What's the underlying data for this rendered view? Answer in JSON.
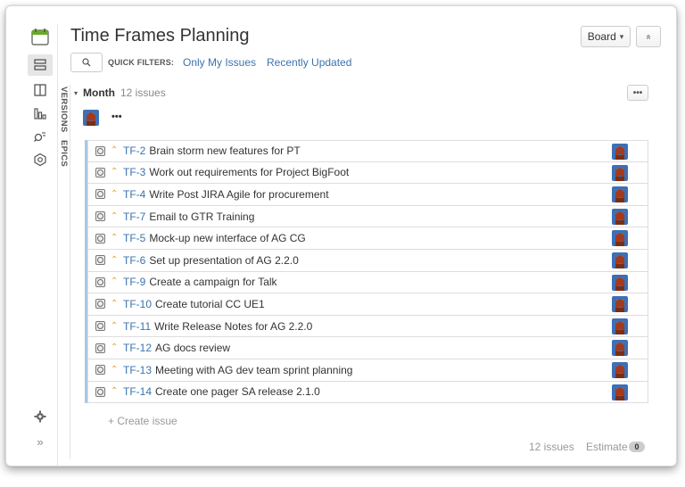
{
  "page": {
    "title": "Time Frames Planning",
    "board_label": "Board",
    "board_caret": "▾",
    "collapse_glyph": "«"
  },
  "quick_filters": {
    "label": "QUICK FILTERS:",
    "filters": [
      "Only My Issues",
      "Recently Updated"
    ]
  },
  "side_tabs": [
    "VERSIONS",
    "EPICS"
  ],
  "sprint": {
    "name": "Month",
    "count": "12 issues",
    "more_label": "•••",
    "assignee_name": "•••",
    "issues": [
      {
        "key": "TF-2",
        "summary": "Brain storm new features for PT"
      },
      {
        "key": "TF-3",
        "summary": "Work out requirements for Project BigFoot"
      },
      {
        "key": "TF-4",
        "summary": "Write Post JIRA Agile for procurement"
      },
      {
        "key": "TF-7",
        "summary": "Email to GTR Training"
      },
      {
        "key": "TF-5",
        "summary": "Mock-up new interface of AG CG"
      },
      {
        "key": "TF-6",
        "summary": "Set up presentation of AG 2.2.0"
      },
      {
        "key": "TF-9",
        "summary": "Create a campaign for Talk"
      },
      {
        "key": "TF-10",
        "summary": "Create tutorial CC UE1"
      },
      {
        "key": "TF-11",
        "summary": "Write Release Notes for AG 2.2.0"
      },
      {
        "key": "TF-12",
        "summary": "AG docs review"
      },
      {
        "key": "TF-13",
        "summary": "Meeting with AG dev team sprint planning"
      },
      {
        "key": "TF-14",
        "summary": "Create one pager SA release 2.1.0"
      }
    ],
    "create_label": "+ Create issue"
  },
  "footer": {
    "issue_count": "12 issues",
    "estimate_label": "Estimate",
    "estimate_value": "0"
  },
  "colors": {
    "link": "#3b73af",
    "sprint_bar": "#a8c8e4",
    "priority": "#e8a020"
  }
}
